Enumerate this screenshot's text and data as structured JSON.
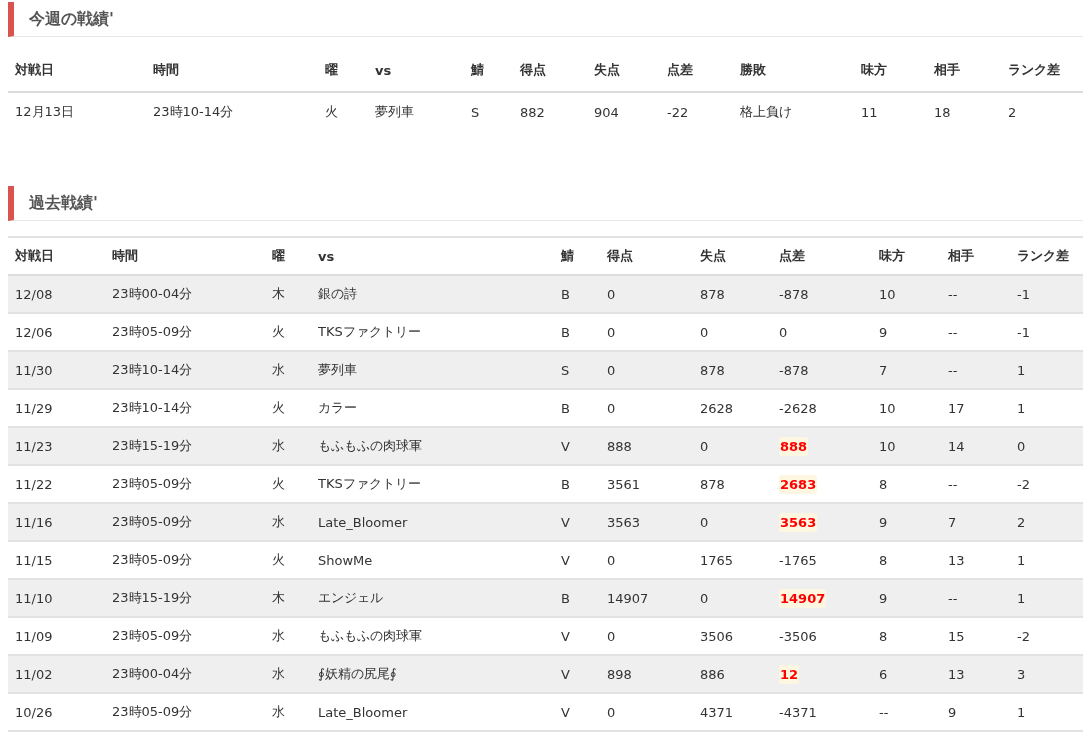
{
  "this_week": {
    "title": "今週の戦績'",
    "columns": [
      "対戦日",
      "時間",
      "曜",
      "vs",
      "鯖",
      "得点",
      "失点",
      "点差",
      "勝敗",
      "味方",
      "相手",
      "ランク差"
    ],
    "rows": [
      {
        "cells": [
          "12月13日",
          "23時10-14分",
          "火",
          "夢列車",
          "S",
          "882",
          "904",
          "-22",
          "格上負け",
          "11",
          "18",
          "2"
        ]
      }
    ]
  },
  "past": {
    "title": "過去戦績'",
    "columns": [
      "対戦日",
      "時間",
      "曜",
      "vs",
      "鯖",
      "得点",
      "失点",
      "点差",
      "味方",
      "相手",
      "ランク差"
    ],
    "rows": [
      {
        "cells": [
          "12/08",
          "23時00-04分",
          "木",
          "銀の詩",
          "B",
          "0",
          "878",
          "-878",
          "10",
          "--",
          "-1"
        ],
        "highlight": false
      },
      {
        "cells": [
          "12/06",
          "23時05-09分",
          "火",
          "TKSファクトリー",
          "B",
          "0",
          "0",
          "0",
          "9",
          "--",
          "-1"
        ],
        "highlight": false
      },
      {
        "cells": [
          "11/30",
          "23時10-14分",
          "水",
          "夢列車",
          "S",
          "0",
          "878",
          "-878",
          "7",
          "--",
          "1"
        ],
        "highlight": false
      },
      {
        "cells": [
          "11/29",
          "23時10-14分",
          "火",
          "カラー",
          "B",
          "0",
          "2628",
          "-2628",
          "10",
          "17",
          "1"
        ],
        "highlight": false
      },
      {
        "cells": [
          "11/23",
          "23時15-19分",
          "水",
          "もふもふの肉球軍",
          "V",
          "888",
          "0",
          "888",
          "10",
          "14",
          "0"
        ],
        "highlight": true
      },
      {
        "cells": [
          "11/22",
          "23時05-09分",
          "火",
          "TKSファクトリー",
          "B",
          "3561",
          "878",
          "2683",
          "8",
          "--",
          "-2"
        ],
        "highlight": true
      },
      {
        "cells": [
          "11/16",
          "23時05-09分",
          "水",
          "Late_Bloomer",
          "V",
          "3563",
          "0",
          "3563",
          "9",
          "7",
          "2"
        ],
        "highlight": true
      },
      {
        "cells": [
          "11/15",
          "23時05-09分",
          "火",
          "ShowMe",
          "V",
          "0",
          "1765",
          "-1765",
          "8",
          "13",
          "1"
        ],
        "highlight": false
      },
      {
        "cells": [
          "11/10",
          "23時15-19分",
          "木",
          "エンジェル",
          "B",
          "14907",
          "0",
          "14907",
          "9",
          "--",
          "1"
        ],
        "highlight": true
      },
      {
        "cells": [
          "11/09",
          "23時05-09分",
          "水",
          "もふもふの肉球軍",
          "V",
          "0",
          "3506",
          "-3506",
          "8",
          "15",
          "-2"
        ],
        "highlight": false
      },
      {
        "cells": [
          "11/02",
          "23時00-04分",
          "水",
          "∮妖精の尻尾∮",
          "V",
          "898",
          "886",
          "12",
          "6",
          "13",
          "3"
        ],
        "highlight": true
      },
      {
        "cells": [
          "10/26",
          "23時05-09分",
          "水",
          "Late_Bloomer",
          "V",
          "0",
          "4371",
          "-4371",
          "--",
          "9",
          "1"
        ],
        "highlight": false
      }
    ]
  }
}
